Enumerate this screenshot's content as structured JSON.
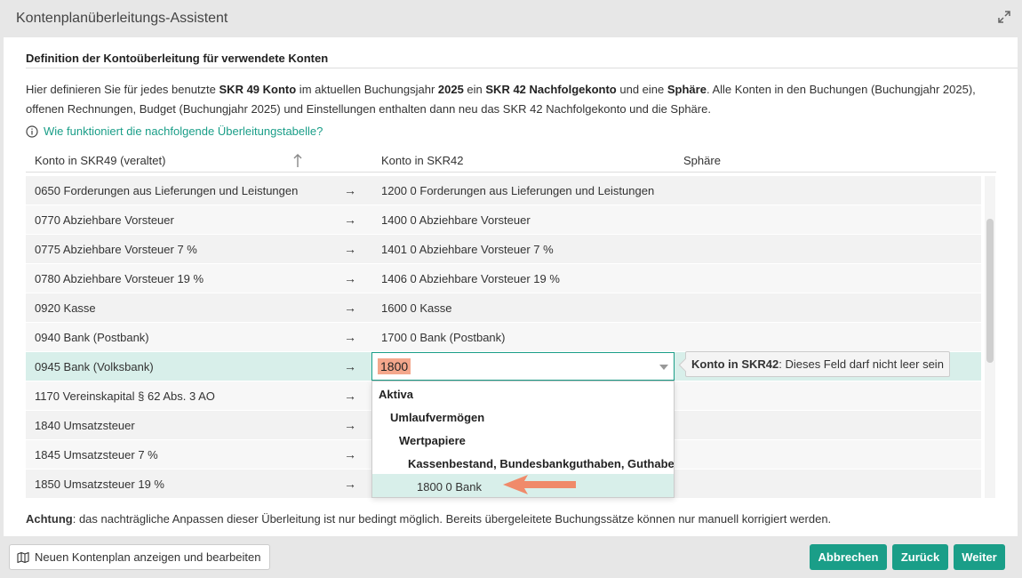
{
  "window": {
    "title": "Kontenplanüberleitungs-Assistent"
  },
  "section_heading": "Definition der Kontoüberleitung für verwendete Konten",
  "intro": {
    "p1": "Hier definieren Sie für jedes benutzte ",
    "b1": "SKR 49 Konto",
    "p2": " im aktuellen Buchungsjahr ",
    "b2": "2025",
    "p3": " ein ",
    "b3": "SKR 42 Nachfolgekonto",
    "p4": " und eine ",
    "b4": "Sphäre",
    "p5": ". Alle Konten in den Buchungen (Buchungjahr 2025), offenen Rechnungen, Budget (Buchungjahr 2025) und Einstellungen enthalten dann neu das SKR 42 Nachfolgekonto und die Sphäre."
  },
  "help_link": "Wie funktioniert die nachfolgende Überleitungstabelle?",
  "table": {
    "headers": {
      "old": "Konto in SKR49 (veraltet)",
      "new": "Konto in SKR42",
      "sphere": "Sphäre"
    },
    "arrow": "→",
    "rows": [
      {
        "old": "0650 Forderungen aus Lieferungen und Leistungen",
        "new": "1200 0 Forderungen aus Lieferungen und Leistungen"
      },
      {
        "old": "0770 Abziehbare Vorsteuer",
        "new": "1400 0 Abziehbare Vorsteuer"
      },
      {
        "old": "0775 Abziehbare Vorsteuer 7 %",
        "new": "1401 0 Abziehbare Vorsteuer 7 %"
      },
      {
        "old": "0780 Abziehbare Vorsteuer 19 %",
        "new": "1406 0 Abziehbare Vorsteuer 19 %"
      },
      {
        "old": "0920 Kasse",
        "new": "1600 0 Kasse"
      },
      {
        "old": "0940 Bank (Postbank)",
        "new": "1700 0 Bank (Postbank)"
      },
      {
        "old": "0945 Bank (Volksbank)",
        "new": ""
      },
      {
        "old": "1170 Vereinskapital § 62 Abs. 3 AO",
        "new": ""
      },
      {
        "old": "1840 Umsatzsteuer",
        "new": ""
      },
      {
        "old": "1845 Umsatzsteuer 7 %",
        "new": ""
      },
      {
        "old": "1850 Umsatzsteuer 19 %",
        "new": ""
      }
    ]
  },
  "combo": {
    "value": "1800"
  },
  "tooltip": {
    "label": "Konto in SKR42",
    "message": ": Dieses Feld darf nicht leer sein"
  },
  "dropdown": {
    "items": [
      {
        "label": "Aktiva",
        "group": true
      },
      {
        "label": "Umlaufvermögen",
        "group": true
      },
      {
        "label": "Wertpapiere",
        "group": true
      },
      {
        "label": "Kassenbestand, Bundesbankguthaben, Guthaben bei Kreditinstituten und Schecks",
        "group": true
      },
      {
        "label": "1800 0 Bank",
        "group": false,
        "selected": true
      }
    ]
  },
  "warning": {
    "bold": "Achtung",
    "text": ": das nachträgliche Anpassen dieser Überleitung ist nur bedingt möglich. Bereits übergeleitete Buchungssätze können nur manuell korrigiert werden."
  },
  "footer": {
    "open_plan": "Neuen Kontenplan anzeigen und bearbeiten",
    "cancel": "Abbrechen",
    "back": "Zurück",
    "next": "Weiter"
  },
  "colors": {
    "accent": "#1a9e88",
    "selection": "#d8efea",
    "highlight": "#f4a78c"
  }
}
